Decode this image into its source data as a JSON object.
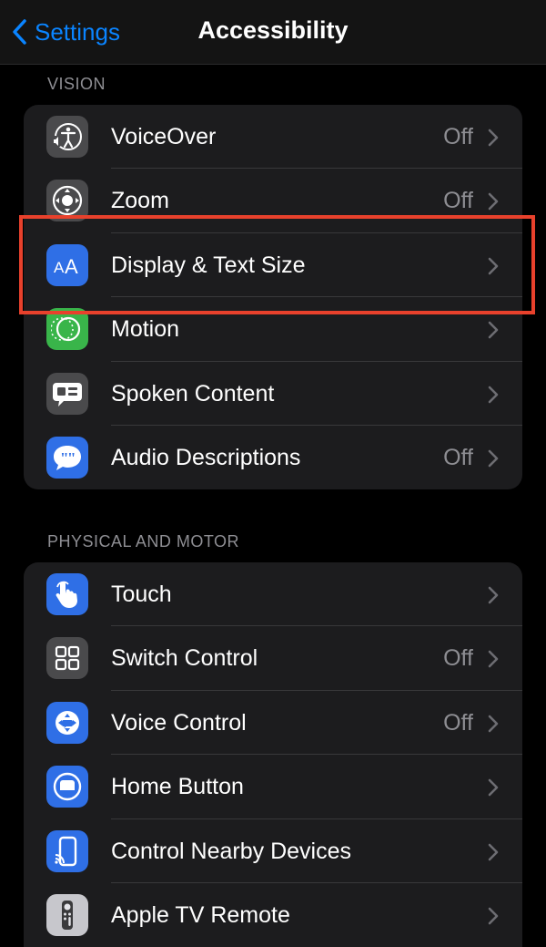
{
  "navbar": {
    "back_label": "Settings",
    "title": "Accessibility"
  },
  "sections": [
    {
      "header": "VISION",
      "items": [
        {
          "label": "VoiceOver",
          "value": "Off",
          "icon": "voiceover-icon"
        },
        {
          "label": "Zoom",
          "value": "Off",
          "icon": "zoom-icon"
        },
        {
          "label": "Display & Text Size",
          "value": "",
          "icon": "text-size-icon"
        },
        {
          "label": "Motion",
          "value": "",
          "icon": "motion-icon"
        },
        {
          "label": "Spoken Content",
          "value": "",
          "icon": "spoken-content-icon"
        },
        {
          "label": "Audio Descriptions",
          "value": "Off",
          "icon": "audio-descriptions-icon"
        }
      ]
    },
    {
      "header": "PHYSICAL AND MOTOR",
      "items": [
        {
          "label": "Touch",
          "value": "",
          "icon": "touch-icon"
        },
        {
          "label": "Switch Control",
          "value": "Off",
          "icon": "switch-control-icon"
        },
        {
          "label": "Voice Control",
          "value": "Off",
          "icon": "voice-control-icon"
        },
        {
          "label": "Home Button",
          "value": "",
          "icon": "home-button-icon"
        },
        {
          "label": "Control Nearby Devices",
          "value": "",
          "icon": "nearby-devices-icon"
        },
        {
          "label": "Apple TV Remote",
          "value": "",
          "icon": "tv-remote-icon"
        }
      ]
    }
  ],
  "colors": {
    "accent": "#0a84ff",
    "highlight": "#e8412c"
  }
}
